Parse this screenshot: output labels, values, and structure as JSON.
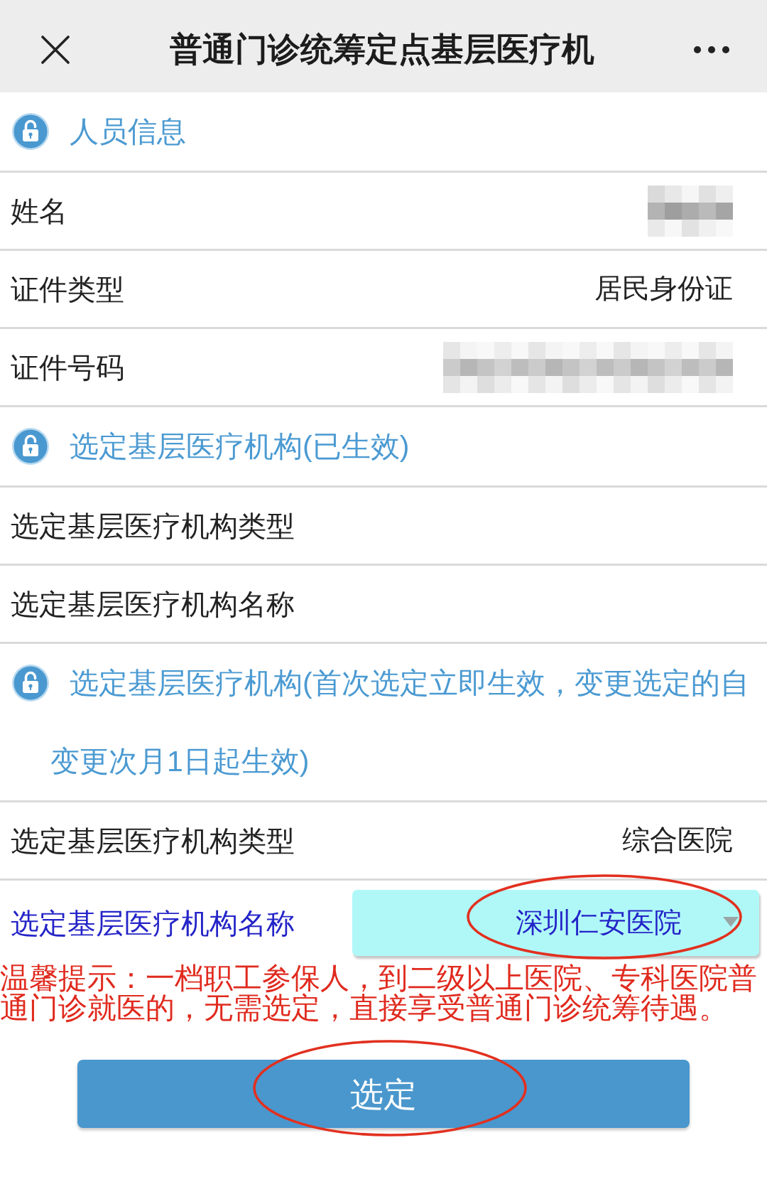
{
  "header": {
    "title": "普通门诊统筹定点基层医疗机"
  },
  "sections": [
    {
      "title": "人员信息",
      "rows": [
        {
          "kind": "text",
          "label": "姓名",
          "redacted": true
        },
        {
          "kind": "text",
          "label": "证件类型",
          "value": "居民身份证",
          "redacted": false
        },
        {
          "kind": "text",
          "label": "证件号码",
          "redacted": true
        }
      ]
    },
    {
      "title": "选定基层医疗机构(已生效)",
      "rows": [
        {
          "kind": "text",
          "label": "选定基层医疗机构类型",
          "redacted": false
        },
        {
          "kind": "text",
          "label": "选定基层医疗机构名称",
          "redacted": false
        }
      ]
    },
    {
      "title": "选定基层医疗机构(首次选定立即生效，变更选定的自变更次月1日起生效)",
      "rows": [
        {
          "kind": "text",
          "label": "选定基层医疗机构类型",
          "value": "综合医院",
          "redacted": false
        },
        {
          "kind": "select",
          "label": "选定基层医疗机构名称",
          "value": "深圳仁安医院",
          "circled": true
        }
      ]
    }
  ],
  "notice": "温馨提示：一档职工参保人，到二级以上医院、专科医院普通门诊就医的，无需选定，直接享受普通门诊统筹待遇。",
  "submit_button": {
    "label": "选定",
    "circled": true
  }
}
